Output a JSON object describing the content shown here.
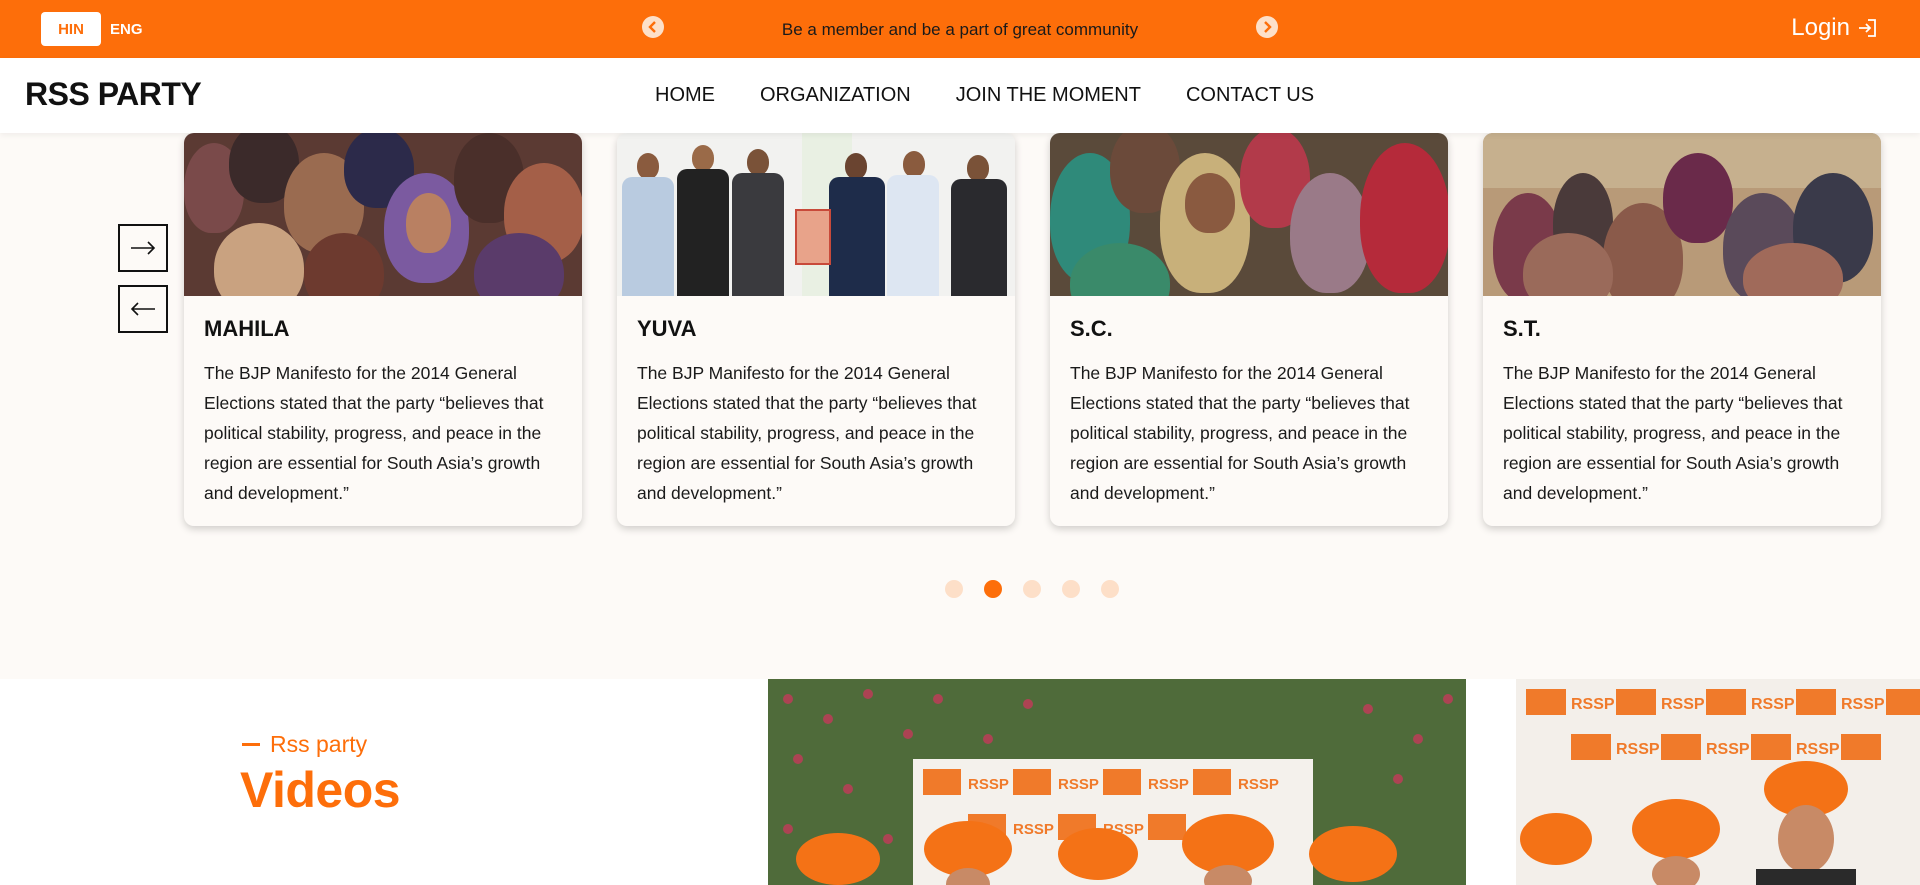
{
  "topbar": {
    "lang_active": "HIN",
    "lang_inactive": "ENG",
    "ticker": "Be a member and be a part of great community",
    "login": "Login",
    "prev_icon": "chevron-left-icon",
    "next_icon": "chevron-right-icon",
    "login_icon": "sign-in-icon"
  },
  "header": {
    "brand": "RSS PARTY",
    "nav": [
      "HOME",
      "ORGANIZATION",
      "JOIN THE MOMENT",
      "CONTACT US"
    ]
  },
  "slider": {
    "next_icon": "arrow-right-icon",
    "prev_icon": "arrow-left-icon",
    "cards": [
      {
        "title": "MAHILA",
        "text": "The BJP Manifesto for the 2014 General Elections stated that the party “believes that political stability, progress, and peace in the region are essential for South Asia’s growth and development.”"
      },
      {
        "title": "YUVA",
        "text": "The BJP Manifesto for the 2014 General Elections stated that the party “believes that political stability, progress, and peace in the region are essential for South Asia’s growth and development.”"
      },
      {
        "title": "S.C.",
        "text": "The BJP Manifesto for the 2014 General Elections stated that the party “believes that political stability, progress, and peace in the region are essential for South Asia’s growth and development.”"
      },
      {
        "title": "S.T.",
        "text": "The BJP Manifesto for the 2014 General Elections stated that the party “believes that political stability, progress, and peace in the region are essential for South Asia’s growth and development.”"
      }
    ],
    "dots_count": 5,
    "active_dot": 2
  },
  "videos": {
    "eyebrow": "Rss party",
    "title": "Videos",
    "banner_text": "RSSP"
  },
  "colors": {
    "accent": "#fd6e0a",
    "accent_light": "#fddfc8",
    "background": "#fdfaf7"
  }
}
